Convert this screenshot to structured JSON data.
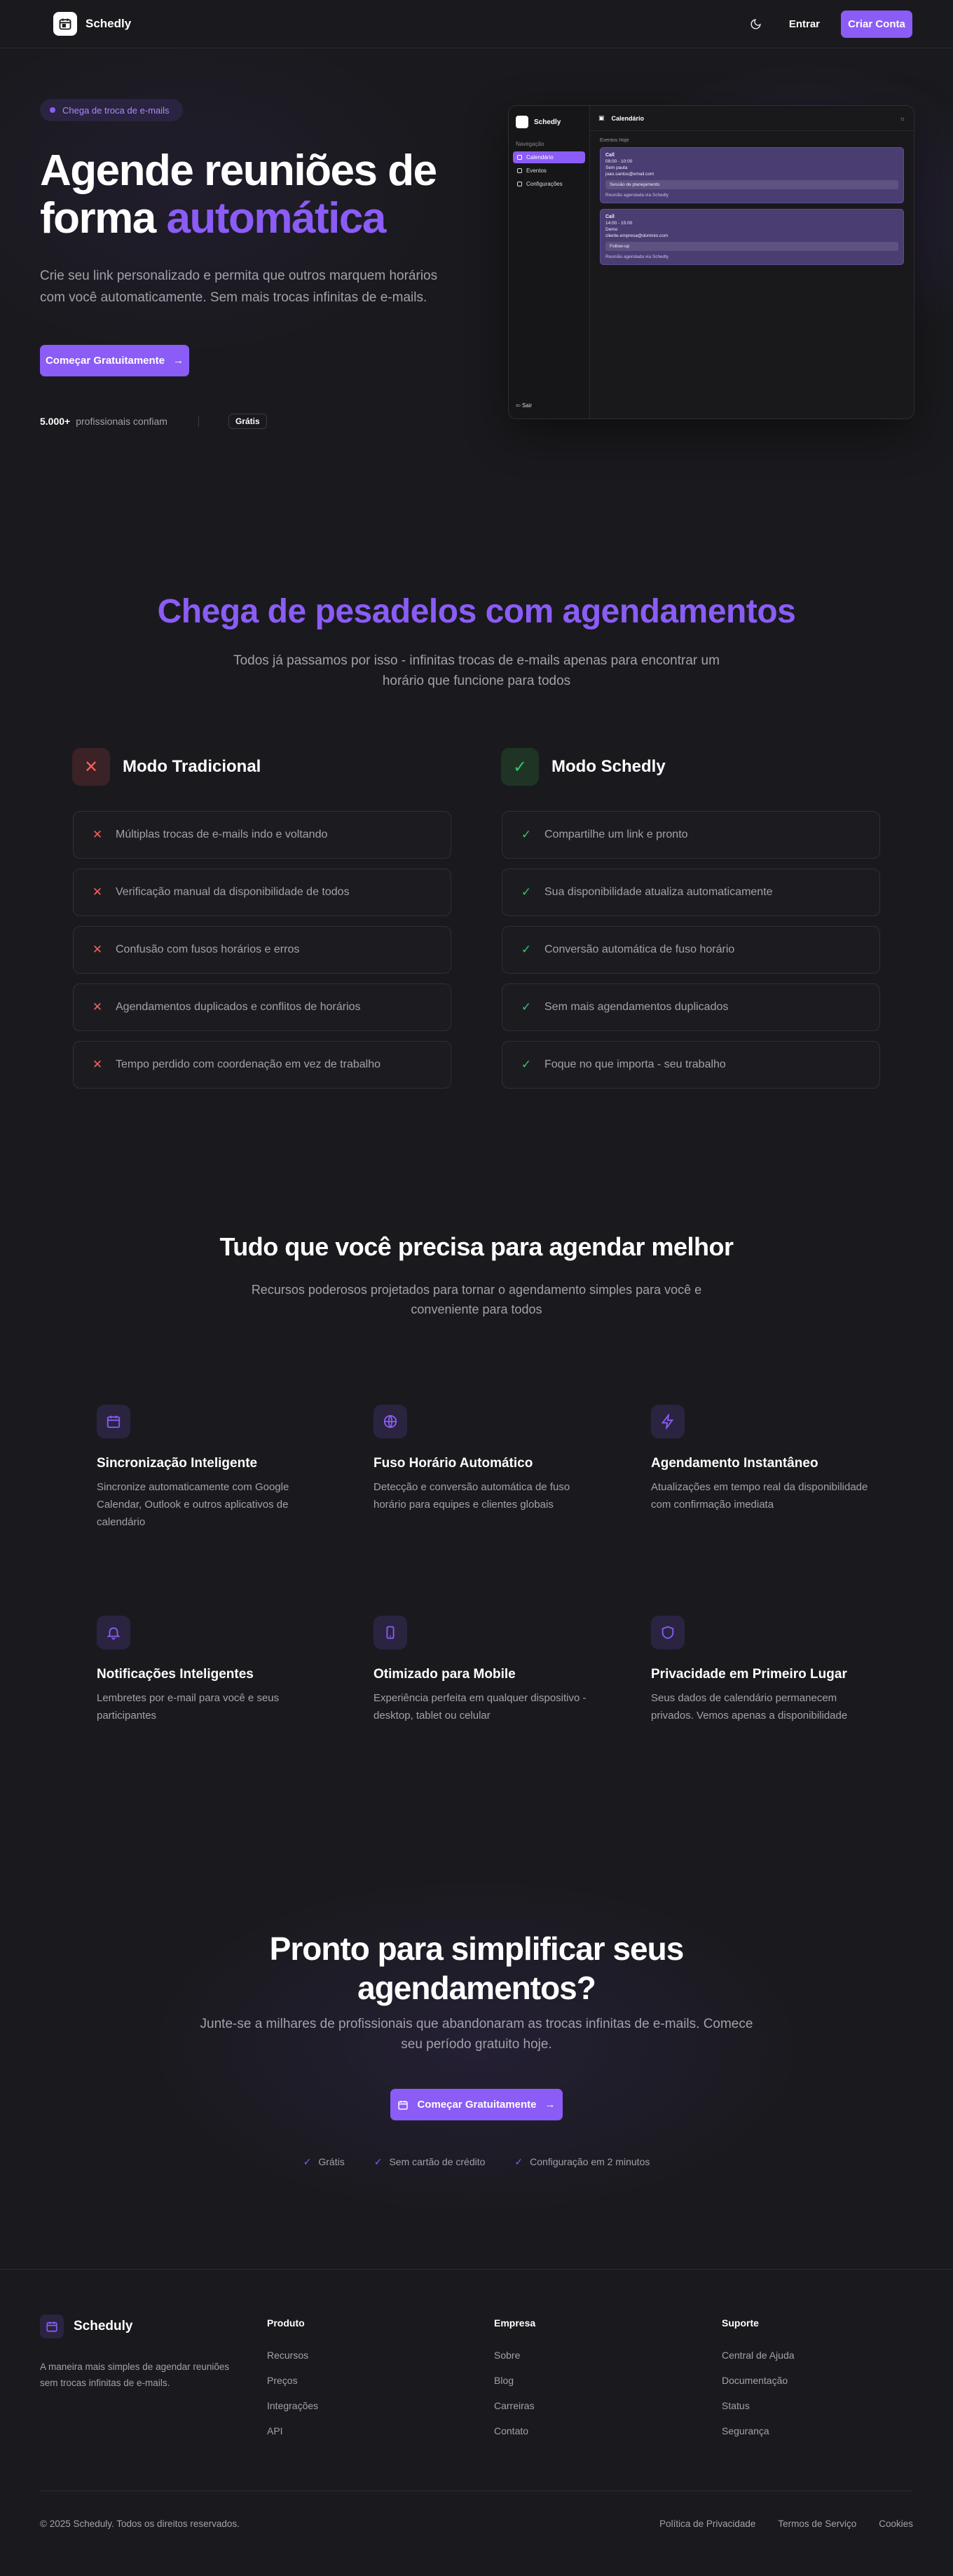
{
  "nav": {
    "brand": "Schedly",
    "login": "Entrar",
    "signup": "Criar Conta"
  },
  "hero": {
    "pill": "Chega de troca de e-mails",
    "title_line1": "Agende reuniões de",
    "title_line2_plain": "forma ",
    "title_line2_accent": "automática",
    "subtitle": "Crie seu link personalizado e permita que outros marquem horários com você automaticamente. Sem mais trocas infinitas de e-mails.",
    "cta": "Começar Gratuitamente",
    "stat_value": "5.000+",
    "stat_label": "profissionais confiam",
    "badge": "Grátis"
  },
  "app_preview": {
    "brand": "Schedly",
    "section": "Navegação",
    "nav": [
      "Calendário",
      "Eventos",
      "Configurações"
    ],
    "logout": "Sair",
    "title": "Calendário",
    "events_header": "Eventos Hoje",
    "events": [
      {
        "title": "Call",
        "time": "09:00 - 10:00",
        "lines": [
          "Sem pauta",
          "joao.santos@email.com"
        ],
        "sub": "Sessão de planejamento",
        "foot": "Reunião agendada via Schedly"
      },
      {
        "title": "Call",
        "time": "14:00 - 15:00",
        "lines": [
          "Demo",
          "cliente.empresa@dominio.com"
        ],
        "sub": "Follow-up",
        "foot": "Reunião agendada via Schedly"
      }
    ]
  },
  "problem": {
    "title": "Chega de pesadelos com agendamentos",
    "subtitle": "Todos já passamos por isso - infinitas trocas de e-mails apenas para encontrar um horário que funcione para todos",
    "traditional_title": "Modo Tradicional",
    "traditional": [
      "Múltiplas trocas de e-mails indo e voltando",
      "Verificação manual da disponibilidade de todos",
      "Confusão com fusos horários e erros",
      "Agendamentos duplicados e conflitos de horários",
      "Tempo perdido com coordenação em vez de trabalho"
    ],
    "schedly_title": "Modo Schedly",
    "schedly": [
      "Compartilhe um link e pronto",
      "Sua disponibilidade atualiza automaticamente",
      "Conversão automática de fuso horário",
      "Sem mais agendamentos duplicados",
      "Foque no que importa - seu trabalho"
    ]
  },
  "features": {
    "title": "Tudo que você precisa para agendar melhor",
    "subtitle": "Recursos poderosos projetados para tornar o agendamento simples para você e conveniente para todos",
    "items": [
      {
        "icon": "calendar-icon",
        "title": "Sincronização Inteligente",
        "desc": "Sincronize automaticamente com Google Calendar, Outlook e outros aplicativos de calendário"
      },
      {
        "icon": "globe-icon",
        "title": "Fuso Horário Automático",
        "desc": "Detecção e conversão automática de fuso horário para equipes e clientes globais"
      },
      {
        "icon": "lightning-icon",
        "title": "Agendamento Instantâneo",
        "desc": "Atualizações em tempo real da disponibilidade com confirmação imediata"
      },
      {
        "icon": "bell-icon",
        "title": "Notificações Inteligentes",
        "desc": "Lembretes por e-mail para você e seus participantes"
      },
      {
        "icon": "mobile-icon",
        "title": "Otimizado para Mobile",
        "desc": "Experiência perfeita em qualquer dispositivo - desktop, tablet ou celular"
      },
      {
        "icon": "shield-icon",
        "title": "Privacidade em Primeiro Lugar",
        "desc": "Seus dados de calendário permanecem privados. Vemos apenas a disponibilidade"
      }
    ]
  },
  "cta": {
    "title_line1": "Pronto para simplificar seus",
    "title_line2": "agendamentos?",
    "subtitle": "Junte-se a milhares de profissionais que abandonaram as trocas infinitas de e-mails. Comece seu período gratuito hoje.",
    "button": "Começar Gratuitamente",
    "checks": [
      "Grátis",
      "Sem cartão de crédito",
      "Configuração em 2 minutos"
    ]
  },
  "footer": {
    "brand": "Scheduly",
    "desc": "A maneira mais simples de agendar reuniões sem trocas infinitas de e-mails.",
    "columns": [
      {
        "title": "Produto",
        "links": [
          "Recursos",
          "Preços",
          "Integrações",
          "API"
        ]
      },
      {
        "title": "Empresa",
        "links": [
          "Sobre",
          "Blog",
          "Carreiras",
          "Contato"
        ]
      },
      {
        "title": "Suporte",
        "links": [
          "Central de Ajuda",
          "Documentação",
          "Status",
          "Segurança"
        ]
      }
    ],
    "copyright": "© 2025 Scheduly. Todos os direitos reservados.",
    "legal": [
      "Política de Privacidade",
      "Termos de Serviço",
      "Cookies"
    ]
  },
  "colors": {
    "accent": "#8b5cf6",
    "background": "#1a1a1e",
    "danger": "#f36060",
    "success": "#35c46a"
  }
}
